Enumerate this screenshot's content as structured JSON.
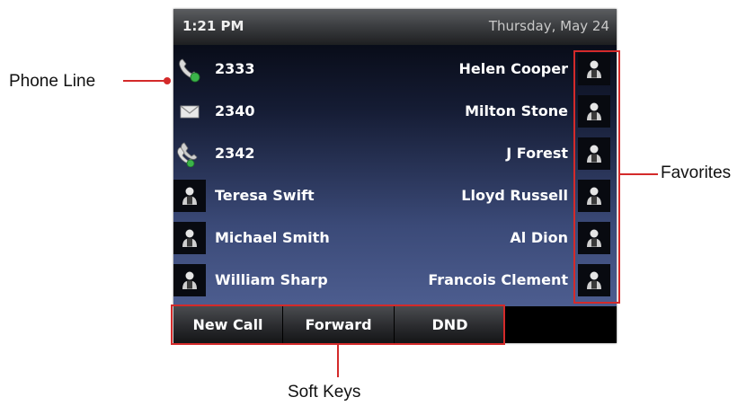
{
  "status": {
    "time": "1:21 PM",
    "date": "Thursday, May 24"
  },
  "lines": [
    {
      "number": "2333",
      "icon": "handset-registered-icon"
    },
    {
      "number": "2340",
      "icon": "envelope-icon"
    },
    {
      "number": "2342",
      "icon": "shared-line-icon"
    }
  ],
  "contacts_left": [
    {
      "name": "Teresa Swift"
    },
    {
      "name": "Michael Smith"
    },
    {
      "name": "William Sharp"
    }
  ],
  "favorites": [
    {
      "name": "Helen Cooper"
    },
    {
      "name": "Milton Stone"
    },
    {
      "name": "J Forest"
    },
    {
      "name": "Lloyd Russell"
    },
    {
      "name": "Al Dion"
    },
    {
      "name": "Francois Clement"
    }
  ],
  "softkeys": [
    {
      "label": "New Call"
    },
    {
      "label": "Forward"
    },
    {
      "label": "DND"
    },
    {
      "label": ""
    }
  ],
  "callouts": {
    "phone_line": "Phone Line",
    "favorites": "Favorites",
    "soft_keys": "Soft Keys"
  },
  "colors": {
    "highlight": "#d42a2a",
    "text": "#ffffff"
  }
}
